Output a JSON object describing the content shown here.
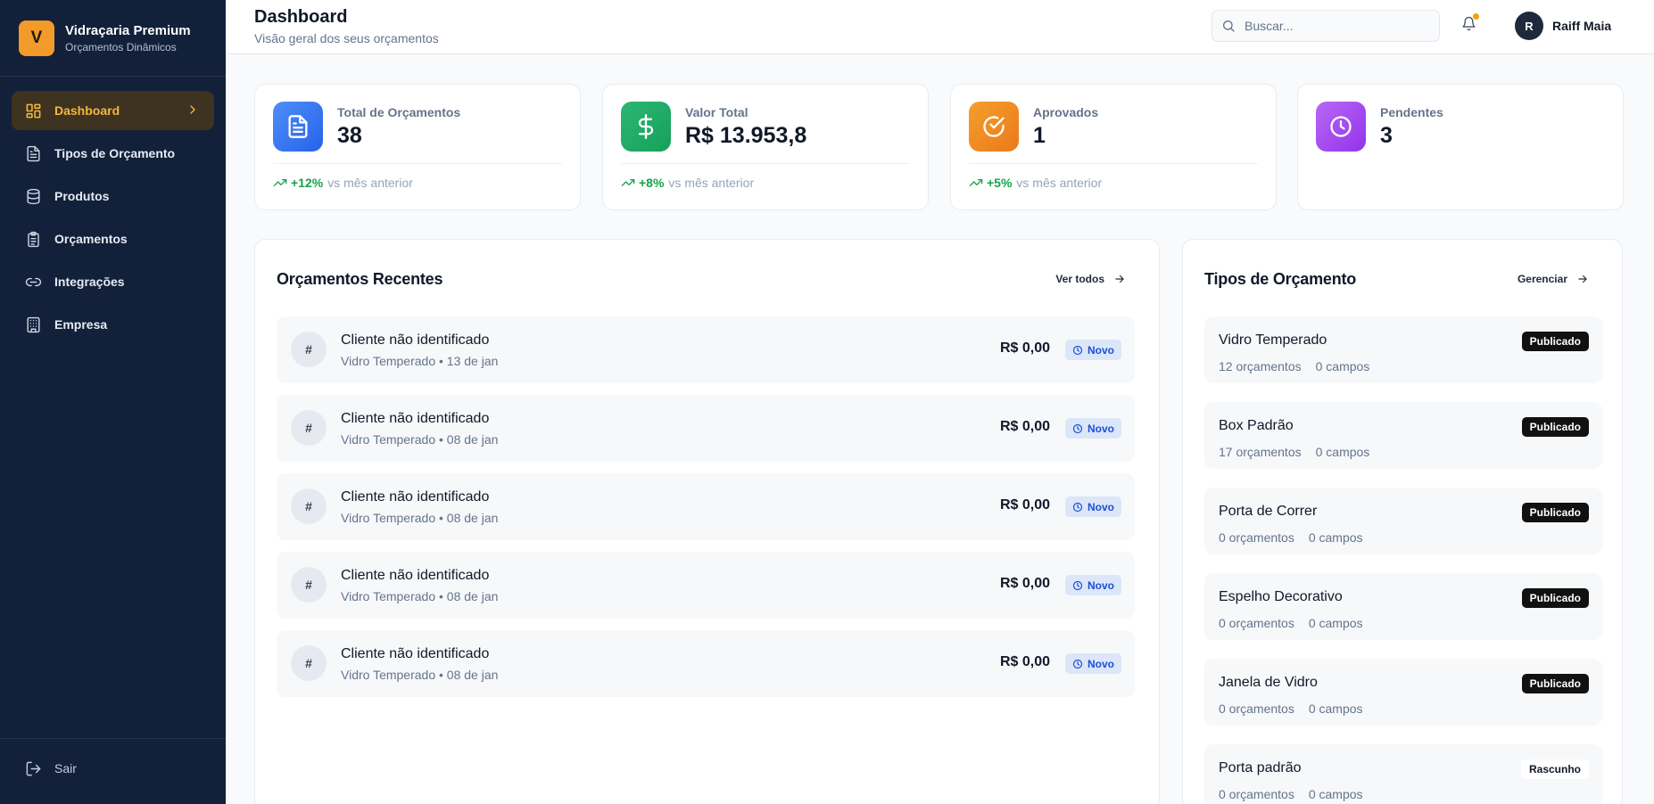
{
  "brand": {
    "logo_letter": "V",
    "name": "Vidraçaria Premium",
    "subtitle": "Orçamentos Dinâmicos"
  },
  "sidebar": {
    "items": [
      {
        "label": "Dashboard",
        "icon": "dashboard-grid-icon",
        "active": true
      },
      {
        "label": "Tipos de Orçamento",
        "icon": "document-icon"
      },
      {
        "label": "Produtos",
        "icon": "database-icon"
      },
      {
        "label": "Orçamentos",
        "icon": "clipboard-icon"
      },
      {
        "label": "Integrações",
        "icon": "link-icon"
      },
      {
        "label": "Empresa",
        "icon": "building-icon"
      }
    ],
    "logout_label": "Sair"
  },
  "header": {
    "title": "Dashboard",
    "subtitle": "Visão geral dos seus orçamentos",
    "search_placeholder": "Buscar...",
    "notification_dot_color": "#f59e0b",
    "user": {
      "initial": "R",
      "name": "Raiff Maia"
    }
  },
  "stats": [
    {
      "label": "Total de Orçamentos",
      "value": "38",
      "trend": "+12%",
      "trend_text": "vs mês anterior",
      "color": "#3b82f6",
      "icon": "file-text-icon"
    },
    {
      "label": "Valor Total",
      "value": "R$ 13.953,8",
      "trend": "+8%",
      "trend_text": "vs mês anterior",
      "color": "#22a55b",
      "icon": "dollar-icon"
    },
    {
      "label": "Aprovados",
      "value": "1",
      "trend": "+5%",
      "trend_text": "vs mês anterior",
      "color": "#f08a24",
      "icon": "check-circle-icon"
    },
    {
      "label": "Pendentes",
      "value": "3",
      "color": "#a855f7",
      "icon": "clock-icon"
    }
  ],
  "recent": {
    "title": "Orçamentos Recentes",
    "link_label": "Ver todos",
    "items": [
      {
        "hash": "#",
        "client": "Cliente não identificado",
        "meta": "Vidro Temperado • 13 de jan",
        "amount": "R$ 0,00",
        "status": "Novo"
      },
      {
        "hash": "#",
        "client": "Cliente não identificado",
        "meta": "Vidro Temperado • 08 de jan",
        "amount": "R$ 0,00",
        "status": "Novo"
      },
      {
        "hash": "#",
        "client": "Cliente não identificado",
        "meta": "Vidro Temperado • 08 de jan",
        "amount": "R$ 0,00",
        "status": "Novo"
      },
      {
        "hash": "#",
        "client": "Cliente não identificado",
        "meta": "Vidro Temperado • 08 de jan",
        "amount": "R$ 0,00",
        "status": "Novo"
      },
      {
        "hash": "#",
        "client": "Cliente não identificado",
        "meta": "Vidro Temperado • 08 de jan",
        "amount": "R$ 0,00",
        "status": "Novo"
      }
    ]
  },
  "types": {
    "title": "Tipos de Orçamento",
    "link_label": "Gerenciar",
    "items": [
      {
        "name": "Vidro Temperado",
        "count": "12 orçamentos",
        "fields": "0 campos",
        "status": "Publicado",
        "published": true
      },
      {
        "name": "Box Padrão",
        "count": "17 orçamentos",
        "fields": "0 campos",
        "status": "Publicado",
        "published": true
      },
      {
        "name": "Porta de Correr",
        "count": "0 orçamentos",
        "fields": "0 campos",
        "status": "Publicado",
        "published": true
      },
      {
        "name": "Espelho Decorativo",
        "count": "0 orçamentos",
        "fields": "0 campos",
        "status": "Publicado",
        "published": true
      },
      {
        "name": "Janela de Vidro",
        "count": "0 orçamentos",
        "fields": "0 campos",
        "status": "Publicado",
        "published": true
      },
      {
        "name": "Porta padrão",
        "count": "0 orçamentos",
        "fields": "0 campos",
        "status": "Rascunho",
        "published": false
      }
    ]
  }
}
